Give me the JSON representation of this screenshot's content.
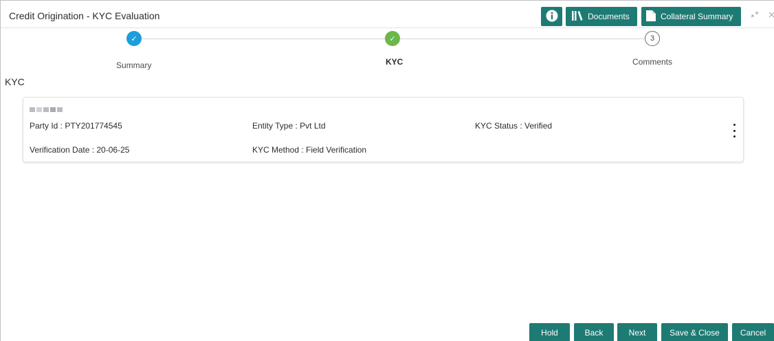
{
  "header": {
    "title": "Credit Origination - KYC Evaluation",
    "info_icon": "info-icon",
    "documents_label": "Documents",
    "documents_icon": "library-icon",
    "collateral_label": "Collateral Summary",
    "collateral_icon": "document-icon",
    "minimize_icon": "minimize-icon",
    "close_icon": "close-icon",
    "accent_color": "#1e7b74"
  },
  "stepper": {
    "steps": [
      {
        "label": "Summary",
        "marker": "✓",
        "state": "done"
      },
      {
        "label": "KYC",
        "marker": "✓",
        "state": "current"
      },
      {
        "label": "Comments",
        "marker": "3",
        "state": "pending"
      }
    ]
  },
  "section": {
    "title": "KYC"
  },
  "card": {
    "party_id": "Party Id : PTY201774545",
    "entity_type": "Entity Type : Pvt Ltd",
    "kyc_status": "KYC Status : Verified",
    "verification_date": "Verification Date : 20-06-25",
    "kyc_method": "KYC Method : Field Verification",
    "menu_icon": "kebab-menu-icon"
  },
  "footer": {
    "hold": "Hold",
    "back": "Back",
    "next": "Next",
    "save_close": "Save & Close",
    "cancel": "Cancel"
  }
}
